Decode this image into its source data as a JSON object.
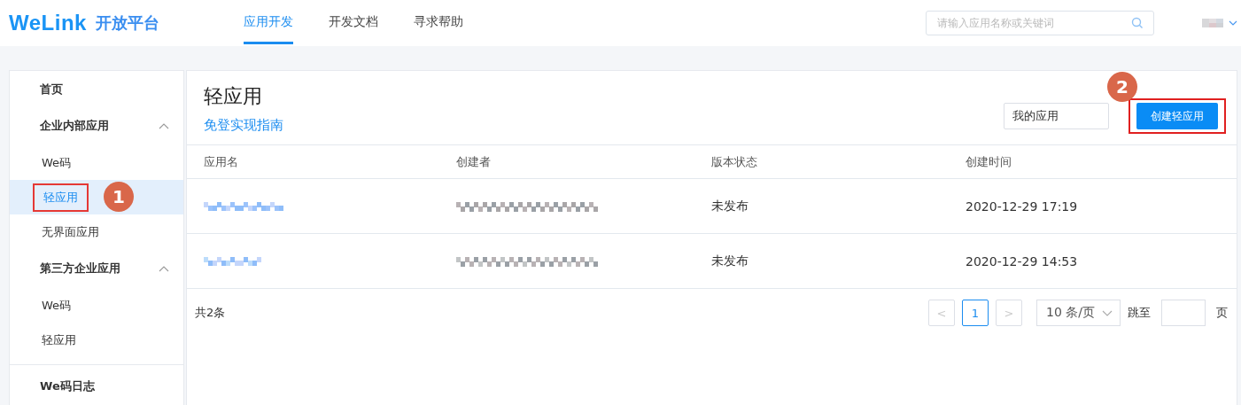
{
  "header": {
    "logo": "WeLink",
    "logo_suffix": "开放平台",
    "nav": [
      {
        "label": "应用开发",
        "selected": true
      },
      {
        "label": "开发文档",
        "selected": false
      },
      {
        "label": "寻求帮助",
        "selected": false
      }
    ],
    "search": {
      "placeholder": "请输入应用名称或关键词"
    }
  },
  "sidebar": {
    "items": [
      {
        "label": "首页",
        "kind": "top",
        "selected": false
      },
      {
        "label": "企业内部应用",
        "kind": "group",
        "expanded": true,
        "children": [
          {
            "label": "We码",
            "selected": false
          },
          {
            "label": "轻应用",
            "selected": true,
            "annotation": "1"
          },
          {
            "label": "无界面应用",
            "selected": false
          }
        ]
      },
      {
        "label": "第三方企业应用",
        "kind": "group",
        "expanded": true,
        "children": [
          {
            "label": "We码",
            "selected": false
          },
          {
            "label": "轻应用",
            "selected": false
          }
        ]
      },
      {
        "label": "We码日志",
        "kind": "top",
        "selected": false
      }
    ]
  },
  "main": {
    "title": "轻应用",
    "guide_link": "免登实现指南",
    "filter": {
      "value": "我的应用"
    },
    "create_button": {
      "label": "创建轻应用",
      "annotation": "2"
    },
    "table": {
      "columns": [
        "应用名",
        "创建者",
        "版本状态",
        "创建时间"
      ],
      "rows": [
        {
          "status": "未发布",
          "created": "2020-12-29 17:19"
        },
        {
          "status": "未发布",
          "created": "2020-12-29 14:53"
        }
      ]
    },
    "footer": {
      "total": "共2条",
      "pages": [
        {
          "label": "1",
          "selected": true
        }
      ],
      "prev": "<",
      "next": ">",
      "page_size": "10 条/页",
      "jump_label": "跳至",
      "page_unit": "页"
    }
  }
}
